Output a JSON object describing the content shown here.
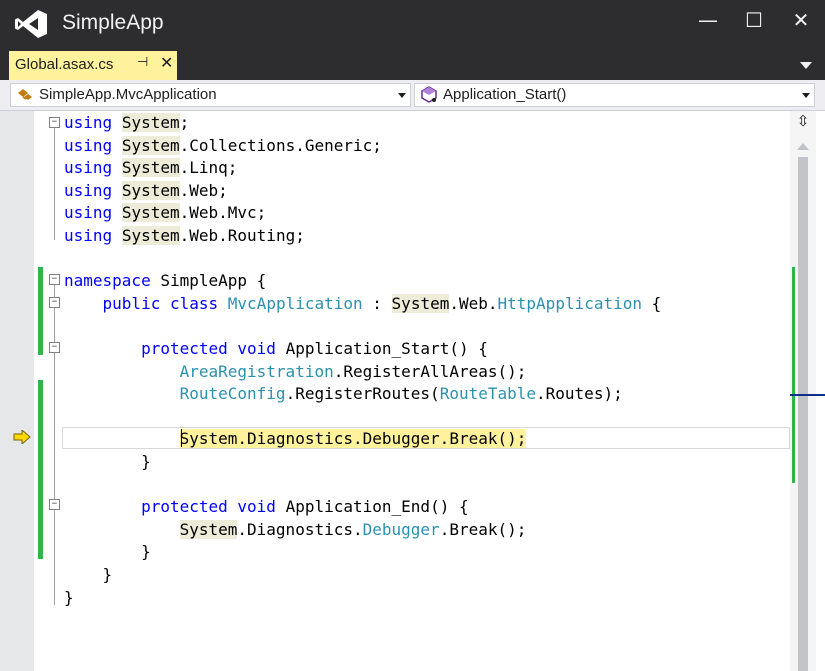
{
  "window": {
    "title": "SimpleApp",
    "controls": {
      "minimize": "—",
      "maximize": "☐",
      "close": "✕"
    }
  },
  "tabs": [
    {
      "label": "Global.asax.cs",
      "pin": "⊣",
      "close": "✕",
      "active": true
    }
  ],
  "navigation": {
    "type_combo": "SimpleApp.MvcApplication",
    "member_combo": "Application_Start()"
  },
  "colors": {
    "keyword": "#0000ff",
    "type": "#2b91af",
    "change_marker": "#2fb54a",
    "current_statement": "#fff29d",
    "title_bar": "#2d2d30"
  },
  "editor": {
    "breakpoint_indicator": "current-statement-arrow",
    "lines": [
      [
        [
          "k",
          "using"
        ],
        [
          "t",
          " "
        ],
        [
          "n",
          "System"
        ],
        [
          "t",
          ";"
        ]
      ],
      [
        [
          "k",
          "using"
        ],
        [
          "t",
          " "
        ],
        [
          "n",
          "System"
        ],
        [
          "t",
          ".Collections.Generic;"
        ]
      ],
      [
        [
          "k",
          "using"
        ],
        [
          "t",
          " "
        ],
        [
          "n",
          "System"
        ],
        [
          "t",
          ".Linq;"
        ]
      ],
      [
        [
          "k",
          "using"
        ],
        [
          "t",
          " "
        ],
        [
          "n",
          "System"
        ],
        [
          "t",
          ".Web;"
        ]
      ],
      [
        [
          "k",
          "using"
        ],
        [
          "t",
          " "
        ],
        [
          "n",
          "System"
        ],
        [
          "t",
          ".Web.Mvc;"
        ]
      ],
      [
        [
          "k",
          "using"
        ],
        [
          "t",
          " "
        ],
        [
          "n",
          "System"
        ],
        [
          "t",
          ".Web.Routing;"
        ]
      ],
      [],
      [
        [
          "k",
          "namespace"
        ],
        [
          "t",
          " SimpleApp {"
        ]
      ],
      [
        [
          "t",
          "    "
        ],
        [
          "k",
          "public"
        ],
        [
          "t",
          " "
        ],
        [
          "k",
          "class"
        ],
        [
          "t",
          " "
        ],
        [
          "y",
          "MvcApplication"
        ],
        [
          "t",
          " : "
        ],
        [
          "n",
          "System"
        ],
        [
          "t",
          ".Web."
        ],
        [
          "y",
          "HttpApplication"
        ],
        [
          "t",
          " {"
        ]
      ],
      [],
      [
        [
          "t",
          "        "
        ],
        [
          "k",
          "protected"
        ],
        [
          "t",
          " "
        ],
        [
          "k",
          "void"
        ],
        [
          "t",
          " Application_Start() {"
        ]
      ],
      [
        [
          "t",
          "            "
        ],
        [
          "y",
          "AreaRegistration"
        ],
        [
          "t",
          ".RegisterAllAreas();"
        ]
      ],
      [
        [
          "t",
          "            "
        ],
        [
          "y",
          "RouteConfig"
        ],
        [
          "t",
          ".RegisterRoutes("
        ],
        [
          "y",
          "RouteTable"
        ],
        [
          "t",
          ".Routes);"
        ]
      ],
      [],
      [
        [
          "t",
          "            "
        ],
        [
          "h",
          "System.Diagnostics.Debugger.Break();"
        ]
      ],
      [
        [
          "t",
          "        }"
        ]
      ],
      [],
      [
        [
          "t",
          "        "
        ],
        [
          "k",
          "protected"
        ],
        [
          "t",
          " "
        ],
        [
          "k",
          "void"
        ],
        [
          "t",
          " Application_End() {"
        ]
      ],
      [
        [
          "t",
          "            "
        ],
        [
          "n",
          "System"
        ],
        [
          "t",
          ".Diagnostics."
        ],
        [
          "y",
          "Debugger"
        ],
        [
          "t",
          ".Break();"
        ]
      ],
      [
        [
          "t",
          "        }"
        ]
      ],
      [
        [
          "t",
          "    }"
        ]
      ],
      [
        [
          "t",
          "}"
        ]
      ]
    ]
  }
}
